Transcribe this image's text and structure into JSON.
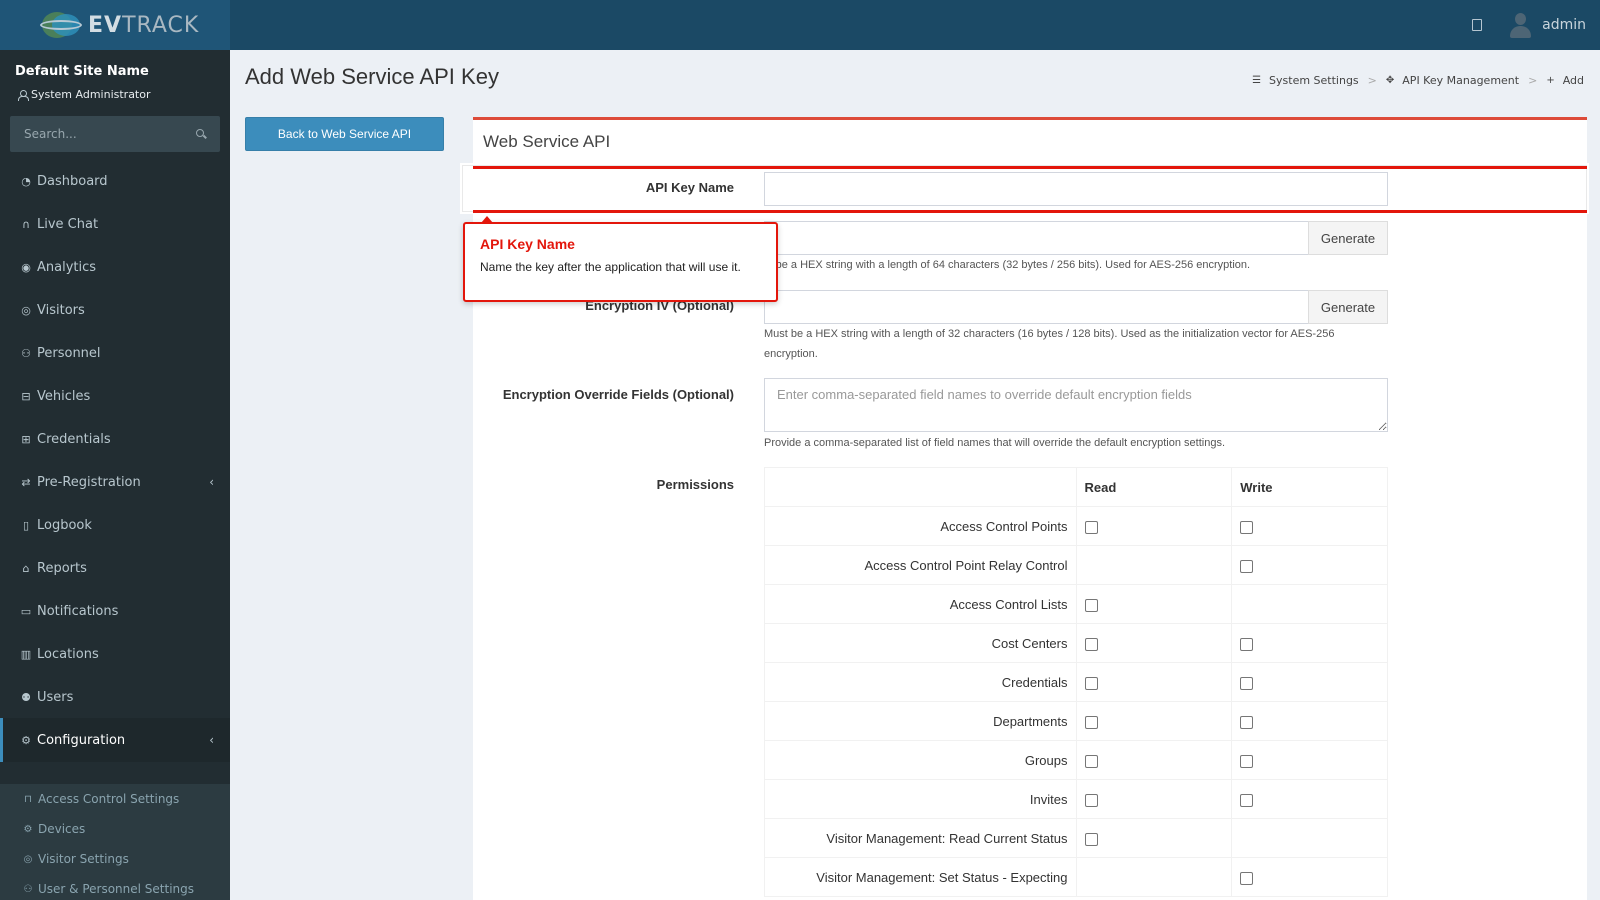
{
  "header": {
    "brand_ev": "EV",
    "brand_track": "TRACK",
    "username": "admin"
  },
  "sidebar": {
    "site_name": "Default Site Name",
    "role": "System Administrator",
    "search_placeholder": "Search...",
    "items": [
      {
        "label": "Dashboard",
        "icon": "dashboard-icon"
      },
      {
        "label": "Live Chat",
        "icon": "headset-icon"
      },
      {
        "label": "Analytics",
        "icon": "target-icon"
      },
      {
        "label": "Visitors",
        "icon": "eye-icon"
      },
      {
        "label": "Personnel",
        "icon": "people-icon"
      },
      {
        "label": "Vehicles",
        "icon": "car-icon"
      },
      {
        "label": "Credentials",
        "icon": "badge-icon"
      },
      {
        "label": "Pre-Registration",
        "icon": "arrows-icon"
      },
      {
        "label": "Logbook",
        "icon": "book-icon"
      },
      {
        "label": "Reports",
        "icon": "chart-icon"
      },
      {
        "label": "Notifications",
        "icon": "chat-icon"
      },
      {
        "label": "Locations",
        "icon": "map-icon"
      },
      {
        "label": "Users",
        "icon": "users-icon"
      },
      {
        "label": "Configuration",
        "icon": "gear-icon"
      }
    ],
    "sub_items": [
      {
        "label": "Access Control Settings",
        "icon": "lock-icon"
      },
      {
        "label": "Devices",
        "icon": "gear-icon"
      },
      {
        "label": "Visitor Settings",
        "icon": "eye-icon"
      },
      {
        "label": "User & Personnel Settings",
        "icon": "people-icon"
      }
    ]
  },
  "page": {
    "title": "Add Web Service API Key",
    "back_button": "Back to Web Service API",
    "breadcrumb": [
      "System Settings",
      "API Key Management",
      "Add"
    ]
  },
  "card": {
    "title": "Web Service API",
    "api_key_name_label": "API Key Name",
    "generate_label": "Generate",
    "encryption_key_help": "st be a HEX string with a length of 64 characters (32 bytes / 256 bits). Used for AES-256 encryption.",
    "encryption_iv_label": "Encryption IV (Optional)",
    "encryption_iv_help": "Must be a HEX string with a length of 32 characters (16 bytes / 128 bits). Used as the initialization vector for AES-256 encryption.",
    "override_label": "Encryption Override Fields (Optional)",
    "override_placeholder": "Enter comma-separated field names to override default encryption fields",
    "override_help": "Provide a comma-separated list of field names that will override the default encryption settings.",
    "permissions_label": "Permissions",
    "permissions_headers": {
      "read": "Read",
      "write": "Write"
    },
    "permissions": [
      {
        "name": "Access Control Points",
        "read": true,
        "write": true
      },
      {
        "name": "Access Control Point Relay Control",
        "read": false,
        "write": true
      },
      {
        "name": "Access Control Lists",
        "read": true,
        "write": false
      },
      {
        "name": "Cost Centers",
        "read": true,
        "write": true
      },
      {
        "name": "Credentials",
        "read": true,
        "write": true
      },
      {
        "name": "Departments",
        "read": true,
        "write": true
      },
      {
        "name": "Groups",
        "read": true,
        "write": true
      },
      {
        "name": "Invites",
        "read": true,
        "write": true
      },
      {
        "name": "Visitor Management: Read Current Status",
        "read": true,
        "write": false
      },
      {
        "name": "Visitor Management: Set Status - Expecting",
        "read": false,
        "write": true
      }
    ]
  },
  "tooltip": {
    "title": "API Key Name",
    "body": "Name the key after the application that will use it."
  },
  "colors": {
    "header": "#1b4965",
    "sidebar": "#222d32",
    "accent": "#3c8dbc",
    "highlight_red": "#e3160b"
  }
}
